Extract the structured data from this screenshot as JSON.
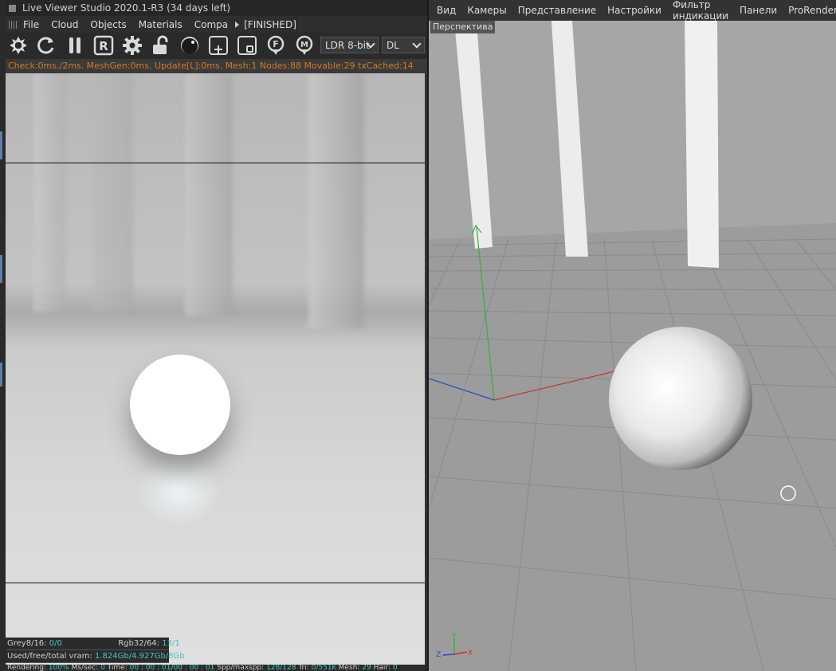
{
  "live_viewer": {
    "title": "Live Viewer Studio 2020.1-R3 (34 days left)",
    "menu": [
      "File",
      "Cloud",
      "Objects",
      "Materials",
      "Compa"
    ],
    "status_finished": "[FINISHED]",
    "toolbar": {
      "icons": [
        "aperture-icon",
        "refresh-icon",
        "pause-icon",
        "region-render-icon",
        "settings-gear-icon",
        "lock-open-icon",
        "material-ball-icon",
        "add-icon",
        "subtract-icon",
        "focus-pin-icon",
        "material-pin-icon"
      ],
      "letter_r": "R",
      "letter_f": "F",
      "letter_m": "M",
      "tonemap_select": "LDR 8-bit",
      "kernel_select": "DL"
    },
    "render_status": "Check:0ms./2ms. MeshGen:0ms. Update[L]:0ms. Mesh:1 Nodes:88 Movable:29 txCached:14",
    "stats": {
      "grey_label": "Grey8/16:",
      "grey_value": "0/0",
      "rgb_label": "Rgb32/64:",
      "rgb_value": "13/1",
      "vram_label": "Used/free/total vram:",
      "vram_value": "1.824Gb/4.927Gb/8Gb"
    },
    "bottom": {
      "rendering_label": "Rendering:",
      "rendering_value": "100%",
      "mssec_label": "Ms/sec:",
      "mssec_value": "0",
      "time_label": "Time:",
      "time_value": "00 : 00 : 01/00 : 00 : 01",
      "spp_label": "Spp/maxspp:",
      "spp_value": "128/128",
      "tri_label": "Tri:",
      "tri_value": "0/551k",
      "mesh_label": "Mesh:",
      "mesh_value": "29",
      "hair_label": "Hair:",
      "hair_value": "0"
    }
  },
  "viewport": {
    "menu": [
      "Вид",
      "Камеры",
      "Представление",
      "Настройки",
      "Фильтр индикации",
      "Панели",
      "ProRender"
    ],
    "camera_label": "Перспектива",
    "axis_labels": {
      "y": "Y",
      "z": "Z",
      "x": "X"
    },
    "colors": {
      "x_axis": "#c83232",
      "y_axis": "#32b432",
      "z_axis": "#3246c8"
    }
  }
}
